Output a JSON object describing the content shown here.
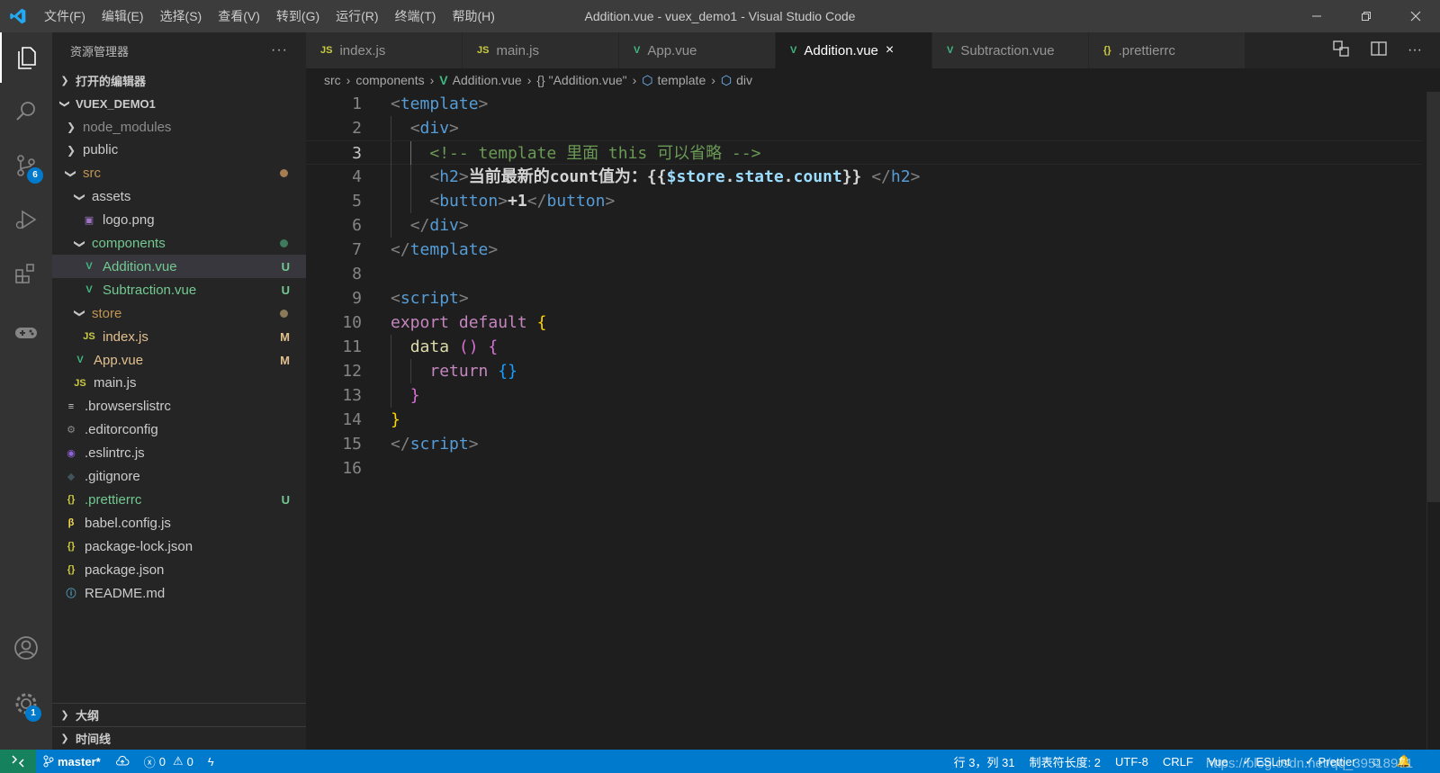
{
  "titlebar": {
    "menu": [
      "文件(F)",
      "编辑(E)",
      "选择(S)",
      "查看(V)",
      "转到(G)",
      "运行(R)",
      "终端(T)",
      "帮助(H)"
    ],
    "title": "Addition.vue - vuex_demo1 - Visual Studio Code"
  },
  "activity": {
    "items": [
      "explorer-icon",
      "search-icon",
      "source-control-icon",
      "run-debug-icon",
      "extensions-icon",
      "remote-gamepad-icon"
    ],
    "scm_badge": "6",
    "settings_badge": "1"
  },
  "sidebar": {
    "title": "资源管理器",
    "more": "···",
    "open_editors": "打开的编辑器",
    "project": "VUEX_DEMO1",
    "tree": [
      {
        "label": "node_modules",
        "type": "folder"
      },
      {
        "label": "public",
        "type": "folder"
      },
      {
        "label": "src",
        "type": "folder"
      },
      {
        "label": "assets",
        "type": "folder"
      },
      {
        "label": "logo.png",
        "type": "image"
      },
      {
        "label": "components",
        "type": "folder"
      },
      {
        "label": "Addition.vue",
        "type": "vue",
        "decoration": "U"
      },
      {
        "label": "Subtraction.vue",
        "type": "vue",
        "decoration": "U"
      },
      {
        "label": "store",
        "type": "folder"
      },
      {
        "label": "index.js",
        "type": "js",
        "decoration": "M"
      },
      {
        "label": "App.vue",
        "type": "vue",
        "decoration": "M"
      },
      {
        "label": "main.js",
        "type": "js"
      },
      {
        "label": ".browserslistrc",
        "type": "list"
      },
      {
        "label": ".editorconfig",
        "type": "gear"
      },
      {
        "label": ".eslintrc.js",
        "type": "eslint"
      },
      {
        "label": ".gitignore",
        "type": "git"
      },
      {
        "label": ".prettierrc",
        "type": "json",
        "decoration": "U"
      },
      {
        "label": "babel.config.js",
        "type": "babel"
      },
      {
        "label": "package-lock.json",
        "type": "json"
      },
      {
        "label": "package.json",
        "type": "json"
      },
      {
        "label": "README.md",
        "type": "info"
      }
    ],
    "outline": "大纲",
    "timeline": "时间线"
  },
  "tabs": [
    {
      "label": "index.js",
      "icon": "JS"
    },
    {
      "label": "main.js",
      "icon": "JS"
    },
    {
      "label": "App.vue",
      "icon": "V"
    },
    {
      "label": "Addition.vue",
      "icon": "V",
      "active": true,
      "close": "×"
    },
    {
      "label": "Subtraction.vue",
      "icon": "V"
    },
    {
      "label": ".prettierrc",
      "icon": "{}"
    }
  ],
  "breadcrumb": [
    "src",
    "components",
    "Addition.vue",
    "{} \"Addition.vue\"",
    "template",
    "div"
  ],
  "editor": {
    "line_numbers": [
      "1",
      "2",
      "3",
      "4",
      "5",
      "6",
      "7",
      "8",
      "9",
      "10",
      "11",
      "12",
      "13",
      "14",
      "15",
      "16"
    ],
    "current_line": 3
  },
  "statusbar": {
    "branch": "master*",
    "errors": "0",
    "warnings": "0",
    "position": "行 3，列 31",
    "tab_size": "制表符长度: 2",
    "encoding": "UTF-8",
    "eol": "CRLF",
    "language": "Vue",
    "eslint": "ESLint",
    "prettier": "Prettier",
    "watermark": "https://blog.csdn.net/qq_39518971"
  },
  "colors": {
    "accent": "#007acc",
    "vue_green": "#41b883",
    "git_untracked": "#73c991",
    "git_modified": "#e2c08d"
  }
}
